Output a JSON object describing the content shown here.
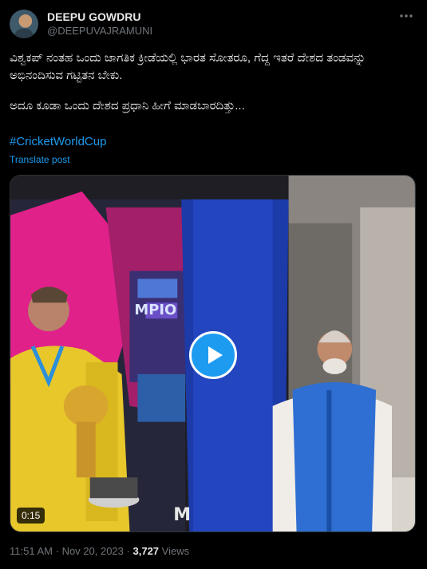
{
  "author": {
    "display_name": "DEEPU GOWDRU",
    "handle": "@DEEPUVAJRAMUNI"
  },
  "post": {
    "text_line_1": "ವಿಶ್ವಕಪ್ ನಂತಹ ಒಂದು ಜಾಗತಿಕ ಕ್ರೀಡೆಯಲ್ಲಿ ಭಾರತ ಸೋತರೂ, ಗೆದ್ದ ಇತರೆ ದೇಶದ ತಂಡವನ್ನು ಅಭಿನಂದಿಸುವ ಗಟ್ಟಿತನ ಬೇಕು.",
    "text_line_2": "ಅದೂ ಕೂಡಾ ಒಂದು ದೇಶದ ಪ್ರಧಾನಿ ಹೀಗೆ ಮಾಡಬಾರದಿತ್ತು...",
    "hashtag": "#CricketWorldCup",
    "translate_label": "Translate post"
  },
  "video": {
    "duration": "0:15",
    "play_icon": "play-icon"
  },
  "meta": {
    "time": "11:51 AM",
    "separator": "·",
    "date": "Nov 20, 2023",
    "views_count": "3,727",
    "views_label": "Views"
  },
  "colors": {
    "background": "#000000",
    "accent": "#1d9bf0",
    "primary_text": "#e7e9ea",
    "secondary_text": "#71767b",
    "border": "#2f3336"
  }
}
